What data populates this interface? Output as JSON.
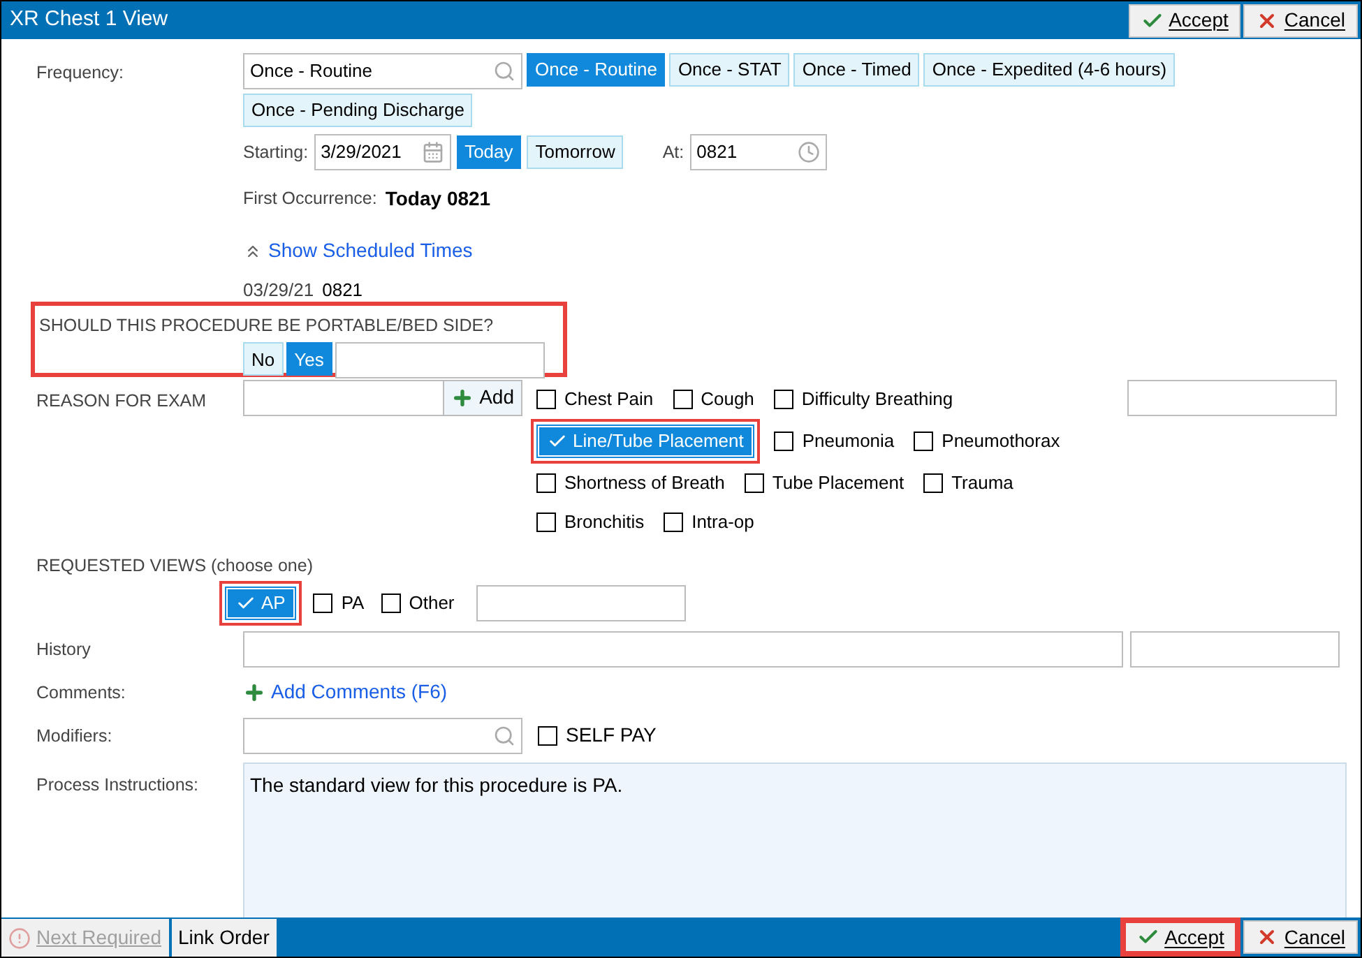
{
  "window": {
    "title": "XR Chest 1 View"
  },
  "title_buttons": [
    {
      "kind": "accept",
      "label": "Accept",
      "highlighted": false
    },
    {
      "kind": "cancel",
      "label": "Cancel",
      "highlighted": false
    }
  ],
  "frequency": {
    "label": "Frequency:",
    "value": "Once - Routine",
    "options": [
      {
        "label": "Once - Routine",
        "selected": true
      },
      {
        "label": "Once - STAT",
        "selected": false
      },
      {
        "label": "Once - Timed",
        "selected": false
      },
      {
        "label": "Once - Expedited (4-6 hours)",
        "selected": false
      },
      {
        "label": "Once - Pending Discharge",
        "selected": false
      }
    ]
  },
  "starting": {
    "label": "Starting:",
    "value": "3/29/2021",
    "days": [
      {
        "label": "Today",
        "selected": true
      },
      {
        "label": "Tomorrow",
        "selected": false
      }
    ],
    "at_label": "At:",
    "at_value": "0821"
  },
  "first_occurrence": {
    "label": "First Occurrence:",
    "value": "Today 0821"
  },
  "scheduled": {
    "link": "Show Scheduled Times",
    "date": "03/29/21",
    "time": "0821"
  },
  "portable": {
    "question": "SHOULD THIS PROCEDURE BE PORTABLE/BED SIDE?",
    "highlighted": true,
    "choices": [
      {
        "label": "No",
        "selected": false
      },
      {
        "label": "Yes",
        "selected": true
      }
    ]
  },
  "reason": {
    "label": "REASON FOR EXAM",
    "add": "Add",
    "options": [
      {
        "label": "Chest Pain",
        "checked": false,
        "highlighted": false
      },
      {
        "label": "Cough",
        "checked": false,
        "highlighted": false
      },
      {
        "label": "Difficulty Breathing",
        "checked": false,
        "highlighted": false
      },
      {
        "label": "Line/Tube Placement",
        "checked": true,
        "highlighted": true
      },
      {
        "label": "Pneumonia",
        "checked": false,
        "highlighted": false
      },
      {
        "label": "Pneumothorax",
        "checked": false,
        "highlighted": false
      },
      {
        "label": "Shortness of Breath",
        "checked": false,
        "highlighted": false
      },
      {
        "label": "Tube Placement",
        "checked": false,
        "highlighted": false
      },
      {
        "label": "Trauma",
        "checked": false,
        "highlighted": false
      },
      {
        "label": "Bronchitis",
        "checked": false,
        "highlighted": false
      },
      {
        "label": "Intra-op",
        "checked": false,
        "highlighted": false
      }
    ]
  },
  "views": {
    "label": "REQUESTED VIEWS (choose one)",
    "items": [
      {
        "label": "AP",
        "checked": true,
        "highlighted": true
      },
      {
        "label": "PA",
        "checked": false,
        "highlighted": false
      },
      {
        "label": "Other",
        "checked": false,
        "highlighted": false
      }
    ]
  },
  "history": {
    "label": "History"
  },
  "comments": {
    "label": "Comments:",
    "link": "Add Comments (F6)"
  },
  "modifiers": {
    "label": "Modifiers:",
    "self_pay": {
      "label": "SELF PAY",
      "checked": false
    }
  },
  "instructions": {
    "label": "Process Instructions:",
    "value": "The standard view for this procedure is PA."
  },
  "footer": {
    "left": [
      {
        "label": "Next Required",
        "disabled": true
      },
      {
        "label": "Link Order",
        "disabled": false
      }
    ],
    "buttons": [
      {
        "kind": "accept",
        "label": "Accept",
        "highlighted": true
      },
      {
        "kind": "cancel",
        "label": "Cancel",
        "highlighted": false
      }
    ]
  }
}
